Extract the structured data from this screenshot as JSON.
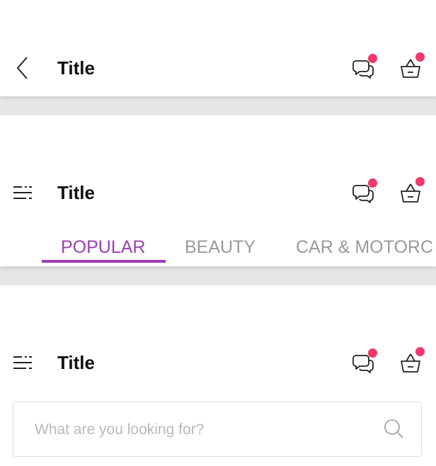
{
  "header_back": {
    "title": "Title",
    "back_icon": "chevron-left-icon",
    "chat_icon": "chat-bubbles-icon",
    "cart_icon": "basket-icon"
  },
  "header_tabs": {
    "title": "Title",
    "menu_icon": "filter-menu-icon",
    "tabs": [
      {
        "label": "POPULAR",
        "active": true
      },
      {
        "label": "BEAUTY",
        "active": false
      },
      {
        "label": "CAR & MOTORC",
        "active": false
      }
    ]
  },
  "header_search": {
    "title": "Title",
    "menu_icon": "filter-menu-icon",
    "search": {
      "placeholder": "What are you looking for?",
      "value": ""
    }
  },
  "colors": {
    "accent": "#9c3fb3",
    "badge": "#f0386b",
    "divider": "#e6e6e6"
  }
}
